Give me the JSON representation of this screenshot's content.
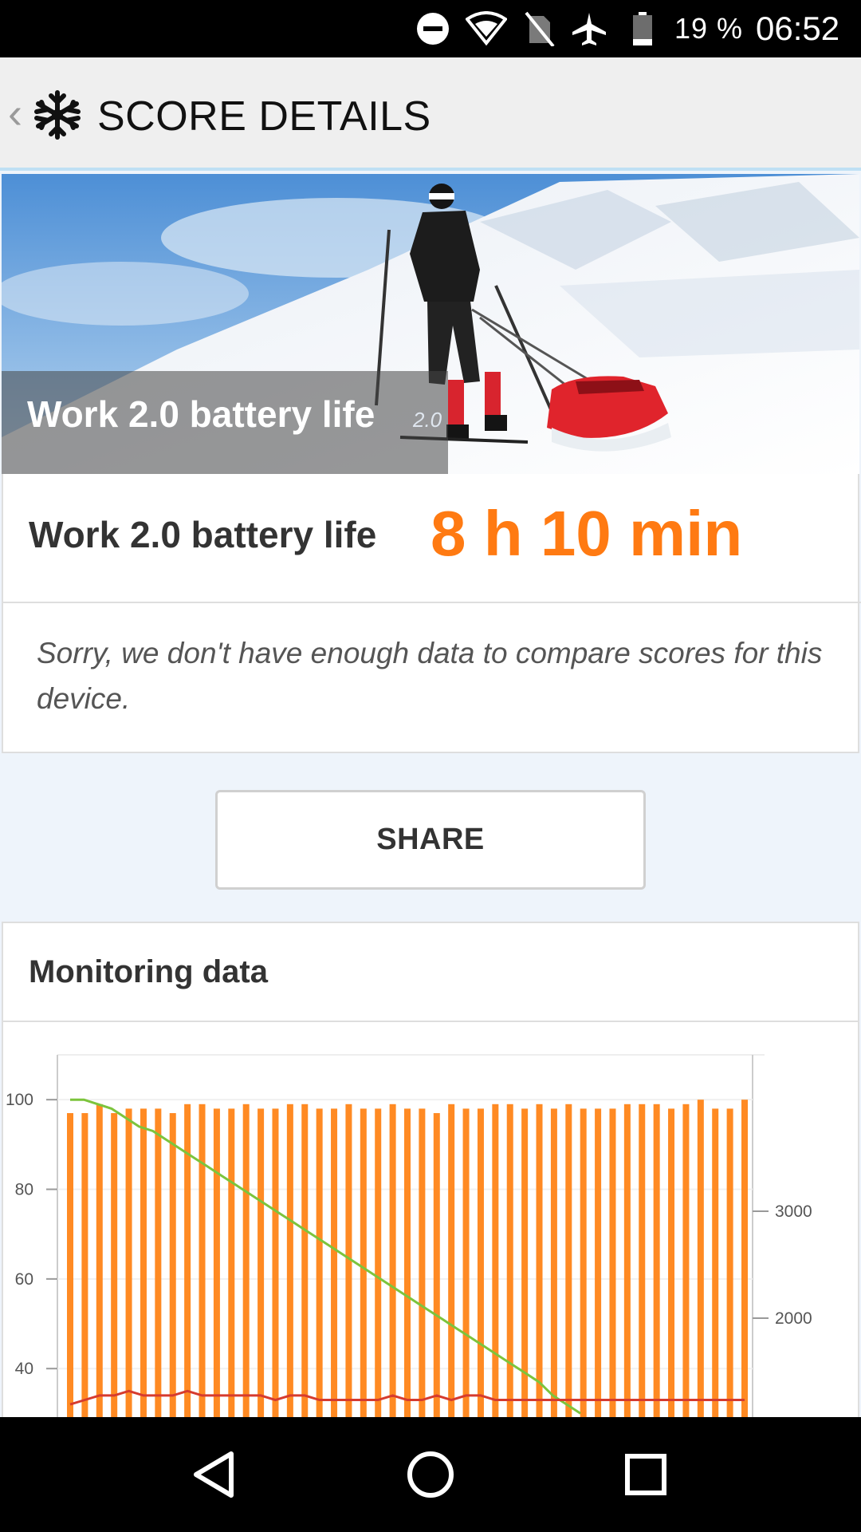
{
  "status_bar": {
    "battery_percent": "19 %",
    "time": "06:52",
    "icons": [
      "do-not-disturb-icon",
      "wifi-icon",
      "no-sim-icon",
      "airplane-mode-icon",
      "battery-icon"
    ]
  },
  "app_bar": {
    "back_icon": "chevron-left-icon",
    "logo_icon": "snowflake-icon",
    "title": "SCORE DETAILS"
  },
  "hero": {
    "image": "skier-pulling-sled-snow-mountain-photo",
    "title": "Work 2.0 battery life",
    "version": "2.0"
  },
  "score": {
    "label": "Work 2.0 battery life",
    "value": "8 h 10 min",
    "value_color": "#ff7a12",
    "message": "Sorry, we don't have enough data to compare scores for this device."
  },
  "share": {
    "label": "SHARE"
  },
  "monitoring": {
    "title": "Monitoring data"
  },
  "chart_data": {
    "type": "bar",
    "left_axis": {
      "ticks": [
        "100",
        "80",
        "60",
        "40"
      ],
      "range": [
        29,
        110
      ]
    },
    "right_axis": {
      "ticks": [
        "3000",
        "2000"
      ]
    },
    "bar_color": "#ff8a23",
    "series": [
      {
        "kind": "bar",
        "color": "#ff8a23",
        "values": [
          97,
          97,
          99,
          97,
          98,
          98,
          98,
          97,
          99,
          99,
          98,
          98,
          99,
          98,
          98,
          99,
          99,
          98,
          98,
          99,
          98,
          98,
          99,
          98,
          98,
          97,
          99,
          98,
          98,
          99,
          99,
          98,
          99,
          98,
          99,
          98,
          98,
          98,
          99,
          99,
          99,
          98,
          99,
          100,
          98,
          98,
          100
        ]
      },
      {
        "kind": "line",
        "color": "#7cc43c",
        "values": [
          100,
          100,
          99,
          98,
          96,
          94,
          93,
          91,
          89,
          87,
          85,
          83,
          81,
          79,
          77,
          75,
          73,
          71,
          69,
          67,
          65,
          63,
          61,
          59,
          57,
          55,
          53,
          51,
          49,
          47,
          45,
          43,
          41,
          39,
          37,
          34,
          32,
          30
        ]
      },
      {
        "kind": "line",
        "color": "#d63b2e",
        "values": [
          32,
          33,
          34,
          34,
          35,
          34,
          34,
          34,
          35,
          34,
          34,
          34,
          34,
          34,
          33,
          34,
          34,
          33,
          33,
          33,
          33,
          33,
          34,
          33,
          33,
          34,
          33,
          34,
          34,
          33,
          33,
          33,
          33,
          33,
          33,
          33,
          33,
          33,
          33,
          33,
          33,
          33,
          33,
          33,
          33,
          33,
          33
        ]
      }
    ]
  },
  "nav_bar": {
    "buttons": [
      "back-triangle-icon",
      "home-circle-icon",
      "recents-square-icon"
    ]
  }
}
